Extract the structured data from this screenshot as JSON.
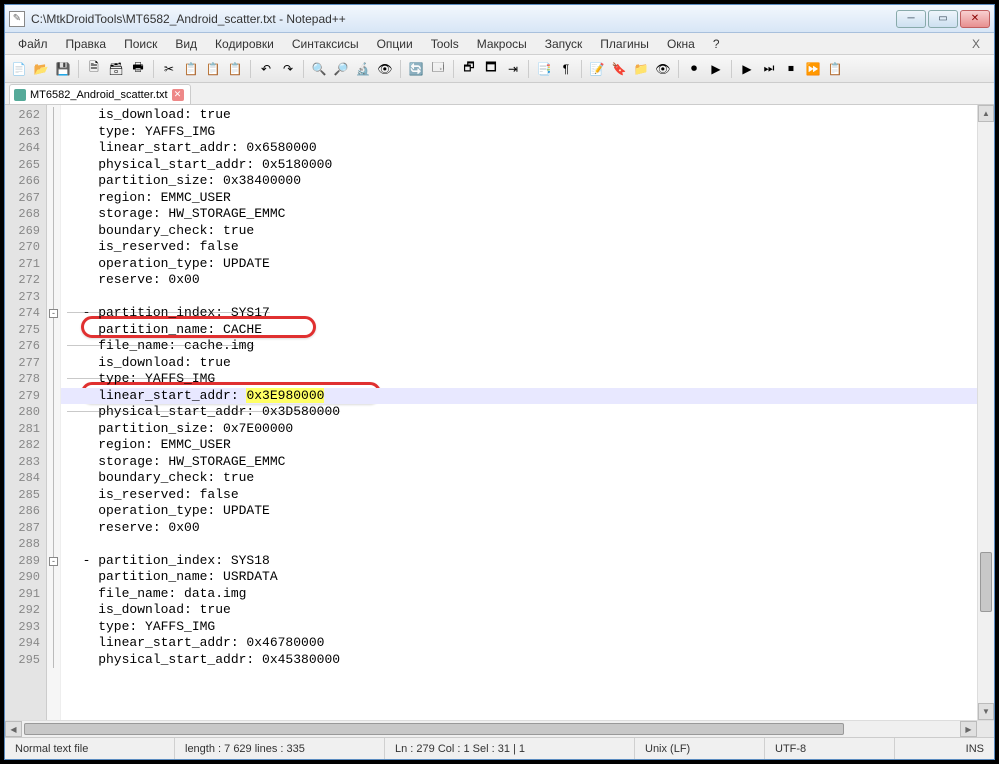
{
  "title": "C:\\MtkDroidTools\\MT6582_Android_scatter.txt - Notepad++",
  "menu": [
    "Файл",
    "Правка",
    "Поиск",
    "Вид",
    "Кодировки",
    "Синтаксисы",
    "Опции",
    "Tools",
    "Макросы",
    "Запуск",
    "Плагины",
    "Окна",
    "?"
  ],
  "tab": {
    "name": "MT6582_Android_scatter.txt"
  },
  "first_line_no": 262,
  "lines": [
    {
      "t": "    is_download: true"
    },
    {
      "t": "    type: YAFFS_IMG"
    },
    {
      "t": "    linear_start_addr: 0x6580000"
    },
    {
      "t": "    physical_start_addr: 0x5180000"
    },
    {
      "t": "    partition_size: 0x38400000"
    },
    {
      "t": "    region: EMMC_USER"
    },
    {
      "t": "    storage: HW_STORAGE_EMMC"
    },
    {
      "t": "    boundary_check: true"
    },
    {
      "t": "    is_reserved: false"
    },
    {
      "t": "    operation_type: UPDATE"
    },
    {
      "t": "    reserve: 0x00"
    },
    {
      "t": ""
    },
    {
      "t": "  - partition_index: SYS17",
      "fold": true,
      "strike": true
    },
    {
      "t": "    partition_name: CACHE"
    },
    {
      "t": "    file_name: cache.img",
      "strike": true
    },
    {
      "t": "    is_download: true"
    },
    {
      "t": "    type: YAFFS_IMG",
      "strike": true
    },
    {
      "t": "    linear_start_addr: ",
      "hl": "0x3E980000",
      "current": true
    },
    {
      "t": "    physical_start_addr: 0x3D580000",
      "strike": true
    },
    {
      "t": "    partition_size: 0x7E00000"
    },
    {
      "t": "    region: EMMC_USER"
    },
    {
      "t": "    storage: HW_STORAGE_EMMC"
    },
    {
      "t": "    boundary_check: true"
    },
    {
      "t": "    is_reserved: false"
    },
    {
      "t": "    operation_type: UPDATE"
    },
    {
      "t": "    reserve: 0x00"
    },
    {
      "t": ""
    },
    {
      "t": "  - partition_index: SYS18",
      "fold": true
    },
    {
      "t": "    partition_name: USRDATA"
    },
    {
      "t": "    file_name: data.img"
    },
    {
      "t": "    is_download: true"
    },
    {
      "t": "    type: YAFFS_IMG"
    },
    {
      "t": "    linear_start_addr: 0x46780000"
    },
    {
      "t": "    physical_start_addr: 0x45380000"
    }
  ],
  "status": {
    "filetype": "Normal text file",
    "length": "length : 7 629   lines : 335",
    "pos": "Ln : 279   Col : 1   Sel : 31 | 1",
    "eol": "Unix (LF)",
    "enc": "UTF-8",
    "ins": "INS"
  },
  "toolbar_icons": [
    "📄",
    "📂",
    "💾",
    "🗎",
    "🗃",
    "🖶",
    "✂",
    "📋",
    "📋",
    "📋",
    "↶",
    "↷",
    "🔍",
    "🔎",
    "🔬",
    "👁",
    "🔄",
    "🗔",
    "🗗",
    "🗖",
    "⇥",
    "📑",
    "¶",
    "📝",
    "🔖",
    "📁",
    "👁",
    "⏺",
    "▶",
    "▶",
    "⏭",
    "⏹",
    "⏩",
    "📋"
  ]
}
